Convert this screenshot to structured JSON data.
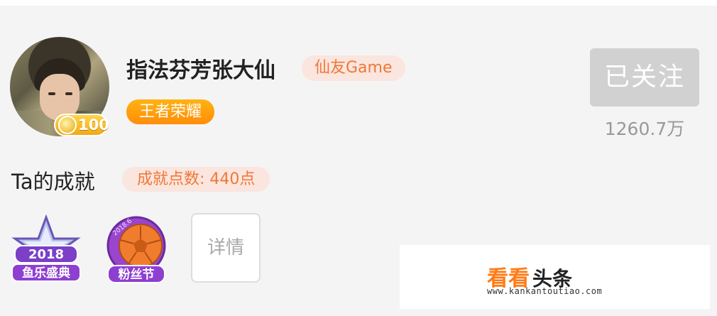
{
  "profile": {
    "username": "指法芬芳张大仙",
    "tag": "仙友Game",
    "game": "王者荣耀",
    "level_badge": "100",
    "follow_label": "已关注",
    "fans_count": "1260.7万"
  },
  "achievements": {
    "title": "Ta的成就",
    "points": "成就点数: 440点",
    "medals": [
      {
        "year": "2018",
        "label": "鱼乐盛典",
        "icon": "star-medal-icon"
      },
      {
        "year": "2018.6",
        "label": "粉丝节",
        "icon": "football-medal-icon"
      }
    ],
    "detail_label": "详情"
  },
  "watermark": {
    "brand_a": "看看",
    "brand_b": "头条",
    "url": "www.kankantoutiao.com"
  },
  "colors": {
    "accent_orange": "#f07836",
    "pill_bg": "#fbe5df",
    "game_pill": "#ff9a0e",
    "followed_gray": "#d1d1d1"
  }
}
